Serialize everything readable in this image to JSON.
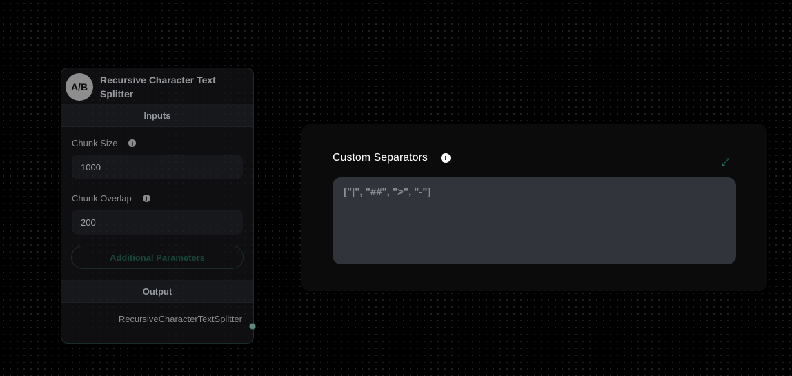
{
  "node": {
    "icon_text": "A/B",
    "title": "Recursive Character Text Splitter",
    "inputs_label": "Inputs",
    "chunk_size": {
      "label": "Chunk Size",
      "value": "1000"
    },
    "chunk_overlap": {
      "label": "Chunk Overlap",
      "value": "200"
    },
    "additional_params": "Additional Parameters",
    "output_label": "Output",
    "output_name": "RecursiveCharacterTextSplitter"
  },
  "panel": {
    "title": "Custom Separators",
    "placeholder": "[\"|\", \"##\", \">\", \"-\"]"
  },
  "colors": {
    "accent": "#2c8a78",
    "background": "#000000"
  }
}
